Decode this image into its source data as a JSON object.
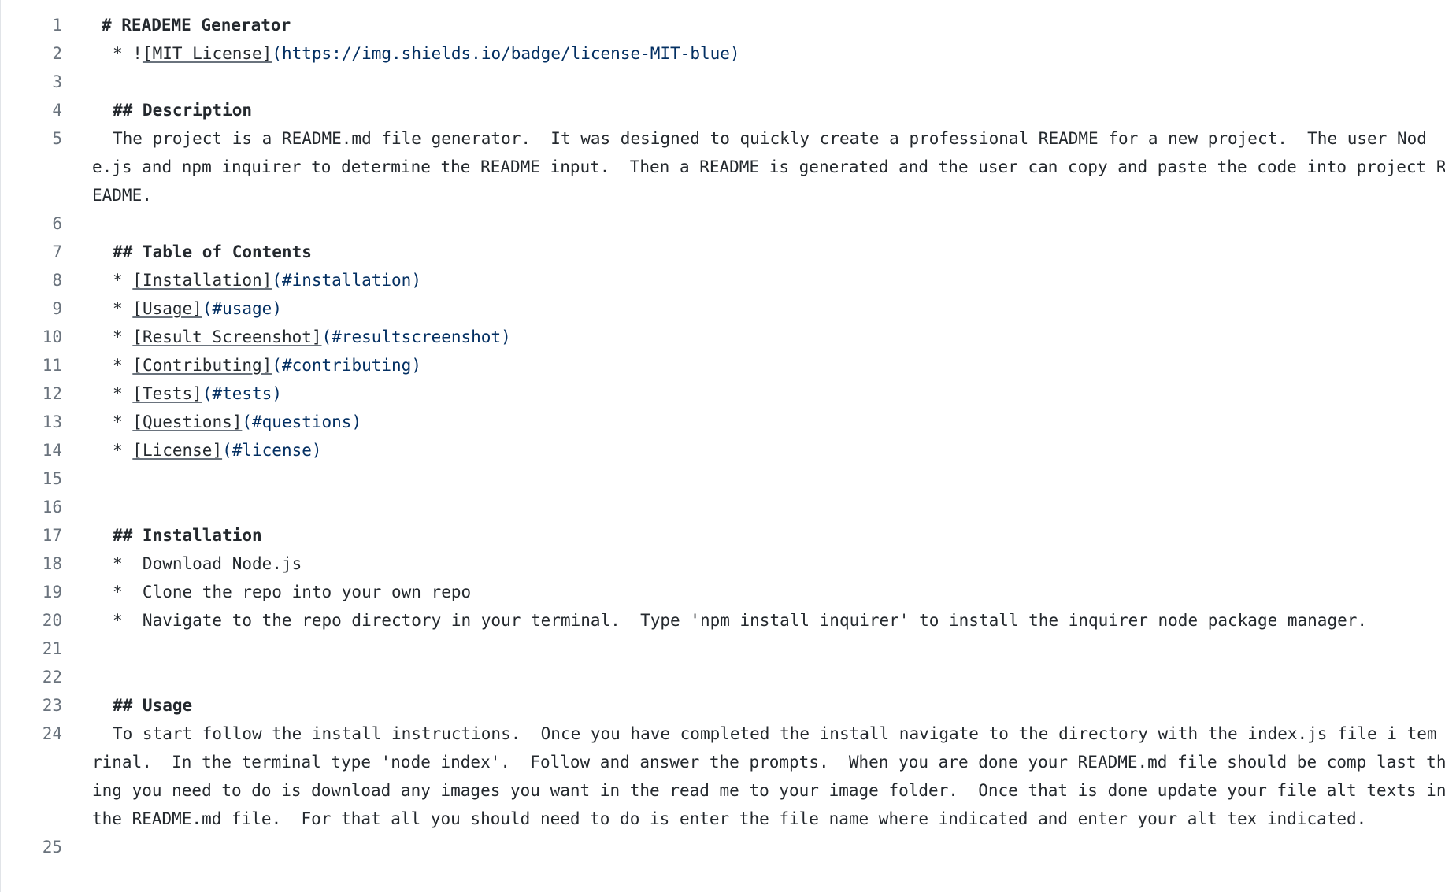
{
  "editor": {
    "lines": [
      {
        "num": "1",
        "parts": [
          {
            "t": "# READEME Generator",
            "s": "bold"
          }
        ],
        "first": true
      },
      {
        "num": "2",
        "parts": [
          {
            "t": "* !",
            "s": ""
          },
          {
            "t": "[MIT License]",
            "s": "link"
          },
          {
            "t": "(https://img.shields.io/badge/license-MIT-blue)",
            "s": "url"
          }
        ]
      },
      {
        "num": "3",
        "parts": []
      },
      {
        "num": "4",
        "parts": [
          {
            "t": "## Description",
            "s": "bold"
          }
        ]
      },
      {
        "num": "5",
        "parts": [
          {
            "t": "The project is a README.md file generator.  It was designed to quickly create a professional README for a new project.  The user Node.js and npm inquirer to determine the README input.  Then a README is generated and the user can copy and paste the code into project README.",
            "s": ""
          }
        ]
      },
      {
        "num": "6",
        "parts": []
      },
      {
        "num": "7",
        "parts": [
          {
            "t": "## Table of Contents",
            "s": "bold"
          }
        ]
      },
      {
        "num": "8",
        "parts": [
          {
            "t": "* ",
            "s": ""
          },
          {
            "t": "[Installation]",
            "s": "link"
          },
          {
            "t": "(#installation)",
            "s": "url"
          }
        ]
      },
      {
        "num": "9",
        "parts": [
          {
            "t": "* ",
            "s": ""
          },
          {
            "t": "[Usage]",
            "s": "link"
          },
          {
            "t": "(#usage)",
            "s": "url"
          }
        ]
      },
      {
        "num": "10",
        "parts": [
          {
            "t": "* ",
            "s": ""
          },
          {
            "t": "[Result Screenshot]",
            "s": "link"
          },
          {
            "t": "(#resultscreenshot)",
            "s": "url"
          }
        ]
      },
      {
        "num": "11",
        "parts": [
          {
            "t": "* ",
            "s": ""
          },
          {
            "t": "[Contributing]",
            "s": "link"
          },
          {
            "t": "(#contributing)",
            "s": "url"
          }
        ]
      },
      {
        "num": "12",
        "parts": [
          {
            "t": "* ",
            "s": ""
          },
          {
            "t": "[Tests]",
            "s": "link"
          },
          {
            "t": "(#tests)",
            "s": "url"
          }
        ]
      },
      {
        "num": "13",
        "parts": [
          {
            "t": "* ",
            "s": ""
          },
          {
            "t": "[Questions]",
            "s": "link"
          },
          {
            "t": "(#questions)",
            "s": "url"
          }
        ]
      },
      {
        "num": "14",
        "parts": [
          {
            "t": "* ",
            "s": ""
          },
          {
            "t": "[License]",
            "s": "link"
          },
          {
            "t": "(#license)",
            "s": "url"
          }
        ]
      },
      {
        "num": "15",
        "parts": []
      },
      {
        "num": "16",
        "parts": []
      },
      {
        "num": "17",
        "parts": [
          {
            "t": "## Installation",
            "s": "bold"
          }
        ]
      },
      {
        "num": "18",
        "parts": [
          {
            "t": "*  Download Node.js",
            "s": ""
          }
        ]
      },
      {
        "num": "19",
        "parts": [
          {
            "t": "*  Clone the repo into your own repo",
            "s": ""
          }
        ]
      },
      {
        "num": "20",
        "parts": [
          {
            "t": "*  Navigate to the repo directory in your terminal.  Type 'npm install inquirer' to install the inquirer node package manager.",
            "s": ""
          }
        ]
      },
      {
        "num": "21",
        "parts": []
      },
      {
        "num": "22",
        "parts": []
      },
      {
        "num": "23",
        "parts": [
          {
            "t": "## Usage",
            "s": "bold"
          }
        ]
      },
      {
        "num": "24",
        "parts": [
          {
            "t": "To start follow the install instructions.  Once you have completed the install navigate to the directory with the index.js file i temrinal.  In the terminal type 'node index'.  Follow and answer the prompts.  When you are done your README.md file should be comp last thing you need to do is download any images you want in the read me to your image folder.  Once that is done update your file alt texts in the README.md file.  For that all you should need to do is enter the file name where indicated and enter your alt tex indicated.",
            "s": ""
          }
        ]
      },
      {
        "num": "25",
        "parts": []
      }
    ]
  }
}
